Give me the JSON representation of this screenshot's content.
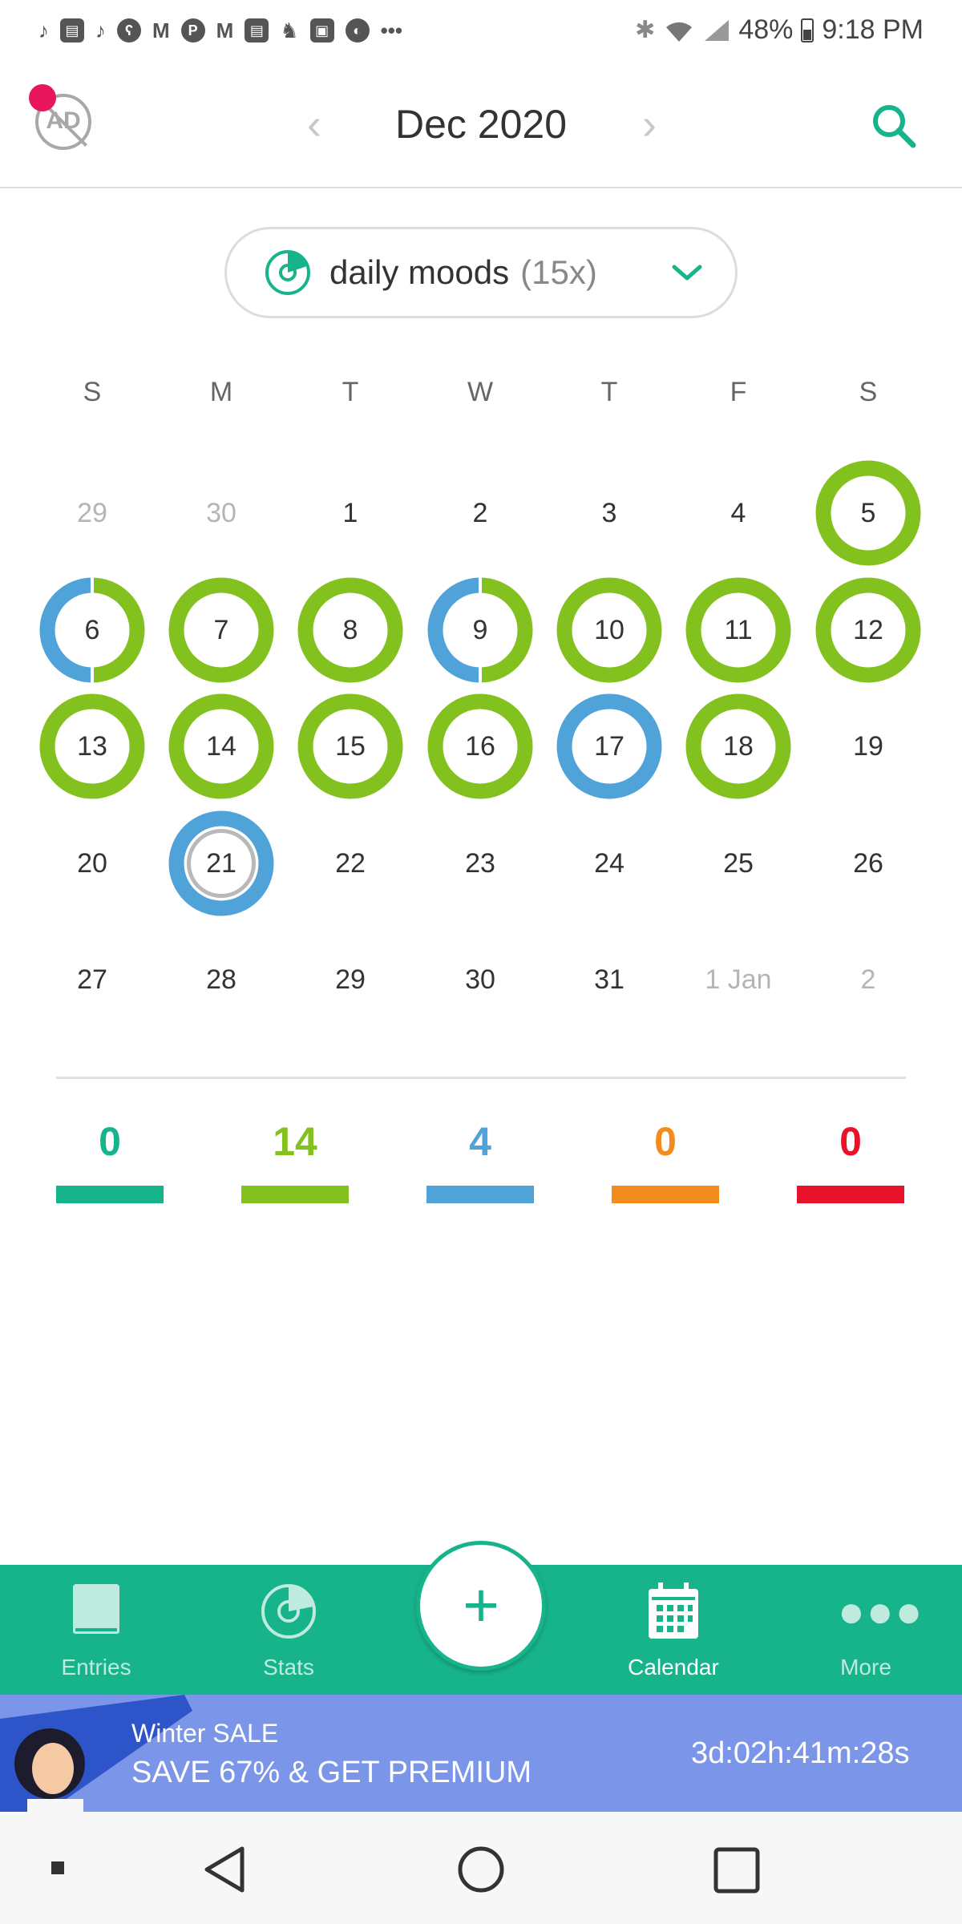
{
  "status_bar": {
    "icons": [
      "tiktok-icon",
      "print-icon",
      "tiktok-icon",
      "bear-icon",
      "mcdonalds-icon",
      "pinterest-icon",
      "mcdonalds-icon",
      "print-icon",
      "rocket-icon",
      "image-icon",
      "compass-icon",
      "more-icon"
    ],
    "battery": "48%",
    "time": "9:18 PM"
  },
  "header": {
    "title": "Dec 2020",
    "prev": "‹",
    "next": "›",
    "ad_icon_text": "AD"
  },
  "filter": {
    "label": "daily moods",
    "count": "(15x)",
    "chevron": "chevron-down-icon"
  },
  "calendar": {
    "weekdays": [
      "S",
      "M",
      "T",
      "W",
      "T",
      "F",
      "S"
    ],
    "weeks": [
      [
        {
          "label": "29",
          "muted": true
        },
        {
          "label": "30",
          "muted": true
        },
        {
          "label": "1"
        },
        {
          "label": "2"
        },
        {
          "label": "3"
        },
        {
          "label": "4"
        },
        {
          "label": "5",
          "ring": [
            "green"
          ]
        }
      ],
      [
        {
          "label": "6",
          "ring": [
            "blue",
            "green"
          ]
        },
        {
          "label": "7",
          "ring": [
            "green"
          ]
        },
        {
          "label": "8",
          "ring": [
            "green"
          ]
        },
        {
          "label": "9",
          "ring": [
            "blue",
            "green"
          ]
        },
        {
          "label": "10",
          "ring": [
            "green"
          ]
        },
        {
          "label": "11",
          "ring": [
            "green"
          ]
        },
        {
          "label": "12",
          "ring": [
            "green"
          ]
        }
      ],
      [
        {
          "label": "13",
          "ring": [
            "green"
          ]
        },
        {
          "label": "14",
          "ring": [
            "green"
          ]
        },
        {
          "label": "15",
          "ring": [
            "green"
          ]
        },
        {
          "label": "16",
          "ring": [
            "green"
          ]
        },
        {
          "label": "17",
          "ring": [
            "blue"
          ]
        },
        {
          "label": "18",
          "ring": [
            "green"
          ]
        },
        {
          "label": "19"
        }
      ],
      [
        {
          "label": "20"
        },
        {
          "label": "21",
          "ring": [
            "blue"
          ],
          "today": true
        },
        {
          "label": "22"
        },
        {
          "label": "23"
        },
        {
          "label": "24"
        },
        {
          "label": "25"
        },
        {
          "label": "26"
        }
      ],
      [
        {
          "label": "27"
        },
        {
          "label": "28"
        },
        {
          "label": "29"
        },
        {
          "label": "30"
        },
        {
          "label": "31"
        },
        {
          "label": "1 Jan",
          "muted": true
        },
        {
          "label": "2",
          "muted": true
        }
      ]
    ]
  },
  "mood_counts": [
    {
      "value": "0",
      "color": "#17b48b"
    },
    {
      "value": "14",
      "color": "#83c11f"
    },
    {
      "value": "4",
      "color": "#4fa3d8"
    },
    {
      "value": "0",
      "color": "#f28c1e"
    },
    {
      "value": "0",
      "color": "#e8132b"
    }
  ],
  "colors": {
    "green": "#83c11f",
    "blue": "#4fa3d8",
    "accent": "#17b48b",
    "promo": "#7b95e8"
  },
  "bottom_nav": {
    "items": [
      {
        "label": "Entries",
        "icon": "book-icon"
      },
      {
        "label": "Stats",
        "icon": "pie-chart-icon"
      },
      {
        "label": "Calendar",
        "icon": "calendar-icon",
        "active": true
      },
      {
        "label": "More",
        "icon": "more-icon"
      }
    ],
    "fab": "+"
  },
  "promo": {
    "line1": "Winter SALE",
    "line2": "SAVE 67% & GET PREMIUM",
    "timer": "3d:02h:41m:28s"
  },
  "android_nav": {
    "buttons": [
      "recent-dot",
      "back-icon",
      "home-icon",
      "overview-icon"
    ]
  }
}
